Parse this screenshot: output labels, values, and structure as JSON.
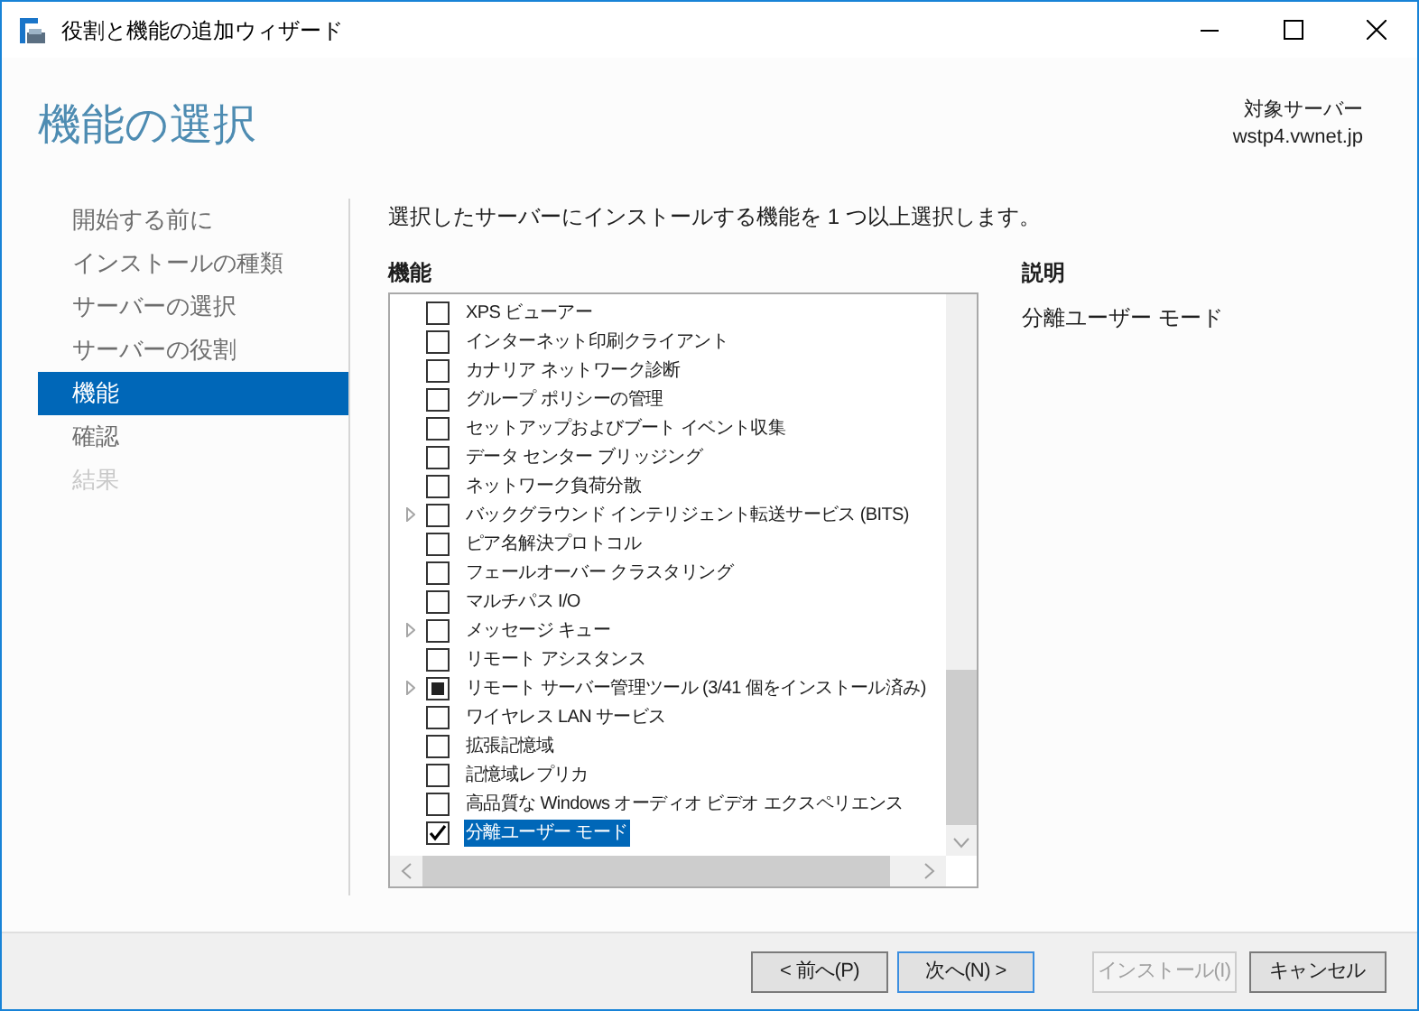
{
  "window": {
    "title": "役割と機能の追加ウィザード"
  },
  "page_title": "機能の選択",
  "target": {
    "label": "対象サーバー",
    "server": "wstp4.vwnet.jp"
  },
  "nav": [
    {
      "label": "開始する前に",
      "selected": false,
      "disabled": false
    },
    {
      "label": "インストールの種類",
      "selected": false,
      "disabled": false
    },
    {
      "label": "サーバーの選択",
      "selected": false,
      "disabled": false
    },
    {
      "label": "サーバーの役割",
      "selected": false,
      "disabled": false
    },
    {
      "label": "機能",
      "selected": true,
      "disabled": false
    },
    {
      "label": "確認",
      "selected": false,
      "disabled": false
    },
    {
      "label": "結果",
      "selected": false,
      "disabled": true
    }
  ],
  "instruction": "選択したサーバーにインストールする機能を 1 つ以上選択します。",
  "features": {
    "heading": "機能",
    "items": [
      {
        "label": "XPS ビューアー",
        "expandable": false,
        "checked": false,
        "partial": false,
        "selected": false
      },
      {
        "label": "インターネット印刷クライアント",
        "expandable": false,
        "checked": false,
        "partial": false,
        "selected": false
      },
      {
        "label": "カナリア ネットワーク診断",
        "expandable": false,
        "checked": false,
        "partial": false,
        "selected": false
      },
      {
        "label": "グループ ポリシーの管理",
        "expandable": false,
        "checked": false,
        "partial": false,
        "selected": false
      },
      {
        "label": "セットアップおよびブート イベント収集",
        "expandable": false,
        "checked": false,
        "partial": false,
        "selected": false
      },
      {
        "label": "データ センター ブリッジング",
        "expandable": false,
        "checked": false,
        "partial": false,
        "selected": false
      },
      {
        "label": "ネットワーク負荷分散",
        "expandable": false,
        "checked": false,
        "partial": false,
        "selected": false
      },
      {
        "label": "バックグラウンド インテリジェント転送サービス (BITS)",
        "expandable": true,
        "checked": false,
        "partial": false,
        "selected": false
      },
      {
        "label": "ピア名解決プロトコル",
        "expandable": false,
        "checked": false,
        "partial": false,
        "selected": false
      },
      {
        "label": "フェールオーバー クラスタリング",
        "expandable": false,
        "checked": false,
        "partial": false,
        "selected": false
      },
      {
        "label": "マルチパス I/O",
        "expandable": false,
        "checked": false,
        "partial": false,
        "selected": false
      },
      {
        "label": "メッセージ キュー",
        "expandable": true,
        "checked": false,
        "partial": false,
        "selected": false
      },
      {
        "label": "リモート アシスタンス",
        "expandable": false,
        "checked": false,
        "partial": false,
        "selected": false
      },
      {
        "label": "リモート サーバー管理ツール (3/41 個をインストール済み)",
        "expandable": true,
        "checked": false,
        "partial": true,
        "selected": false
      },
      {
        "label": "ワイヤレス LAN サービス",
        "expandable": false,
        "checked": false,
        "partial": false,
        "selected": false
      },
      {
        "label": "拡張記憶域",
        "expandable": false,
        "checked": false,
        "partial": false,
        "selected": false
      },
      {
        "label": "記憶域レプリカ",
        "expandable": false,
        "checked": false,
        "partial": false,
        "selected": false
      },
      {
        "label": "高品質な Windows オーディオ ビデオ エクスペリエンス",
        "expandable": false,
        "checked": false,
        "partial": false,
        "selected": false
      },
      {
        "label": "分離ユーザー モード",
        "expandable": false,
        "checked": true,
        "partial": false,
        "selected": true
      }
    ]
  },
  "description": {
    "heading": "説明",
    "text": "分離ユーザー モード"
  },
  "buttons": [
    {
      "label": "< 前へ(P)",
      "disabled": false,
      "focused": false
    },
    {
      "label": "次へ(N) >",
      "disabled": false,
      "focused": true
    },
    {
      "label": "インストール(I)",
      "disabled": true,
      "focused": false
    },
    {
      "label": "キャンセル",
      "disabled": false,
      "focused": false
    }
  ]
}
